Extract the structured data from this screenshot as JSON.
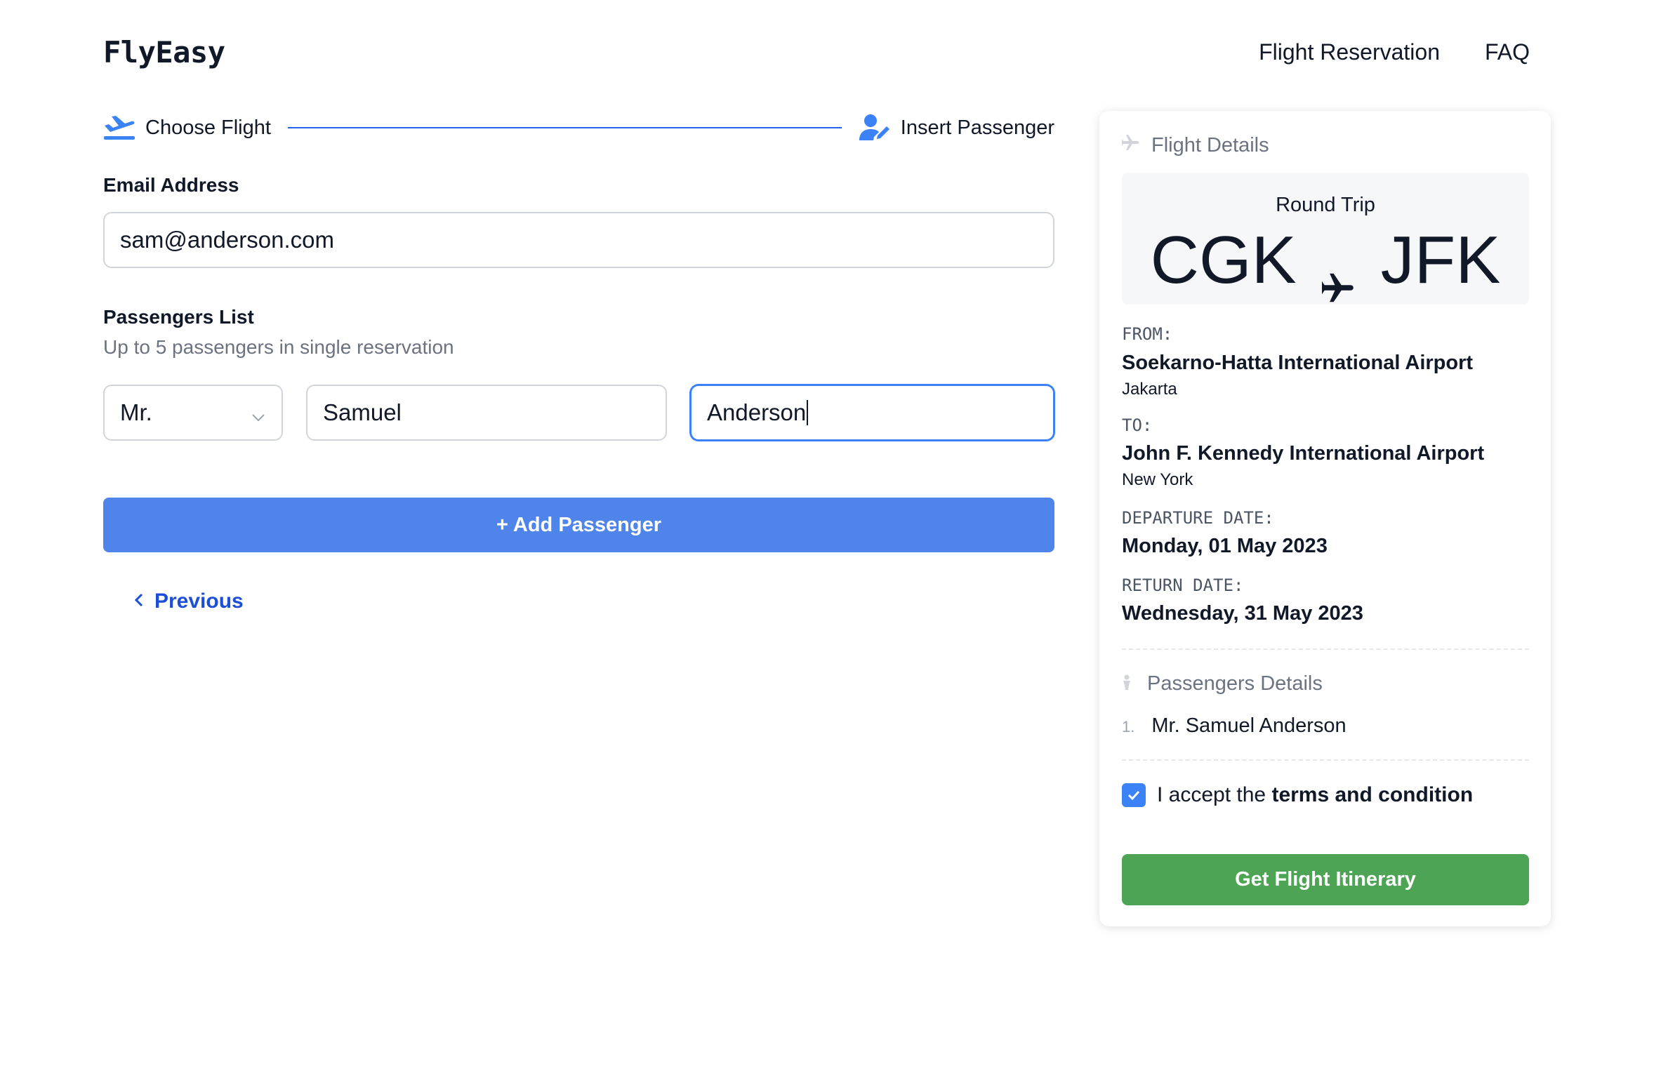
{
  "header": {
    "brand": "FlyEasy",
    "nav": [
      "Flight Reservation",
      "FAQ"
    ]
  },
  "stepper": {
    "step1": "Choose Flight",
    "step2": "Insert Passenger"
  },
  "form": {
    "email_label": "Email Address",
    "email_value": "sam@anderson.com",
    "passengers_label": "Passengers List",
    "passengers_hint": "Up to 5 passengers in single reservation",
    "passenger": {
      "title": "Mr.",
      "first_name": "Samuel",
      "last_name": "Anderson"
    },
    "add_button": "+ Add Passenger",
    "previous": "Previous"
  },
  "summary": {
    "heading": "Flight Details",
    "trip_type": "Round Trip",
    "from_code": "CGK",
    "to_code": "JFK",
    "from_label": "FROM:",
    "from_airport": "Soekarno-Hatta International Airport",
    "from_city": "Jakarta",
    "to_label": "TO:",
    "to_airport": "John F. Kennedy International Airport",
    "to_city": "New York",
    "departure_label": "DEPARTURE DATE:",
    "departure_date": "Monday, 01 May 2023",
    "return_label": "RETURN DATE:",
    "return_date": "Wednesday, 31 May 2023",
    "passengers_heading": "Passengers Details",
    "passengers": [
      {
        "num": "1.",
        "name": "Mr. Samuel Anderson"
      }
    ],
    "terms_prefix": "I accept the",
    "terms_bold": "terms and condition",
    "terms_checked": true,
    "itinerary_button": "Get Flight Itinerary"
  },
  "colors": {
    "primary": "#4f84ea",
    "link": "#1d4ed8",
    "success": "#4ea455",
    "step_line": "#2563eb"
  }
}
